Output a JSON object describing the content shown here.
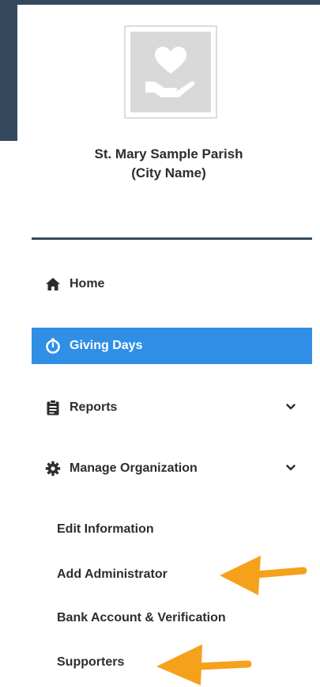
{
  "organization": {
    "name_line1": "St. Mary Sample Parish",
    "name_line2": "(City Name)",
    "logo_icon": "heart-in-hand-icon"
  },
  "nav": {
    "items": [
      {
        "label": "Home",
        "icon": "home-icon"
      },
      {
        "label": "Giving Days",
        "icon": "stopwatch-icon",
        "active": true
      },
      {
        "label": "Reports",
        "icon": "clipboard-icon",
        "expandable": true
      },
      {
        "label": "Manage Organization",
        "icon": "gear-icon",
        "expandable": true
      }
    ],
    "manage_submenu": [
      "Edit Information",
      "Add Administrator",
      "Bank Account & Verification",
      "Supporters"
    ]
  },
  "annotations": {
    "arrow_color": "#f5a11c",
    "arrows_point_to": [
      "Add Administrator",
      "Supporters"
    ]
  },
  "colors": {
    "accent": "#2f8fe6",
    "dark": "#34495e",
    "text": "#2d2d2d"
  }
}
